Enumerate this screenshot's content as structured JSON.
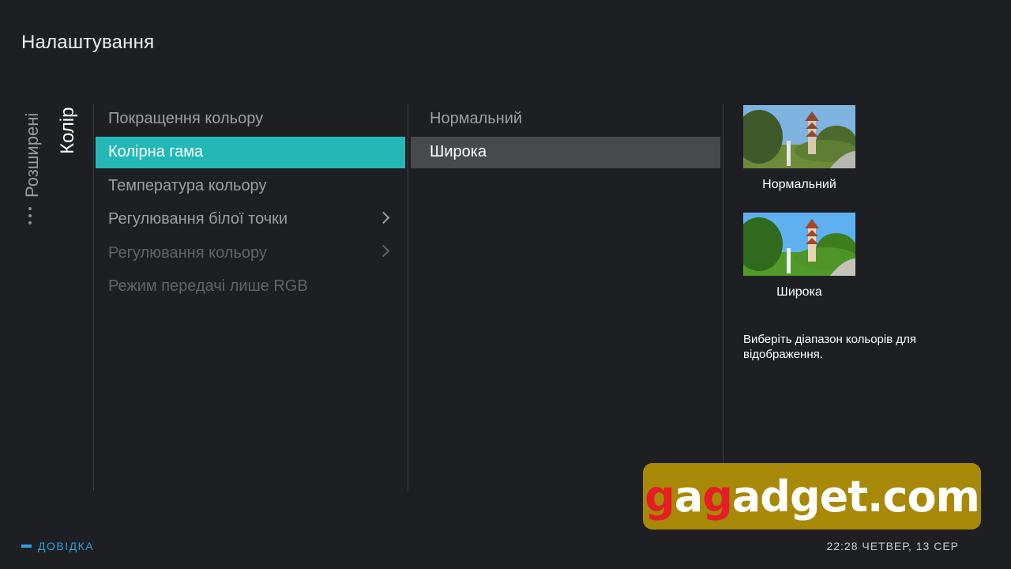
{
  "header": {
    "title": "Налаштування"
  },
  "breadcrumb": {
    "parent": "Розширені",
    "current": "Колір"
  },
  "menu": {
    "items": [
      {
        "label": "Покращення кольору",
        "state": "normal",
        "submenu": false
      },
      {
        "label": "Колірна гама",
        "state": "active",
        "submenu": false
      },
      {
        "label": "Температура кольору",
        "state": "normal",
        "submenu": false
      },
      {
        "label": "Регулювання білої точки",
        "state": "normal",
        "submenu": true
      },
      {
        "label": "Регулювання кольору",
        "state": "disabled",
        "submenu": true
      },
      {
        "label": "Режим передачі лише RGB",
        "state": "disabled",
        "submenu": false
      }
    ]
  },
  "options": {
    "items": [
      {
        "label": "Нормальний",
        "selected": false
      },
      {
        "label": "Широка",
        "selected": true
      }
    ]
  },
  "preview": {
    "items": [
      {
        "label": "Нормальний"
      },
      {
        "label": "Широка"
      }
    ],
    "description": "Виберіть діапазон кольорів для відображення."
  },
  "footer": {
    "help_label": "ДОВІДКА",
    "clock": "22:28 ЧЕТВЕР, 13 СЕР"
  },
  "watermark": {
    "part1": "g",
    "part2": "a",
    "part3": "g",
    "part4": "adget.com"
  },
  "colors": {
    "background": "#1e1f22",
    "accent": "#23b8b6",
    "selected_option": "#48494c",
    "help": "#2aa0dc",
    "watermark_bg": "#a88807",
    "watermark_red": "#e51e25"
  }
}
